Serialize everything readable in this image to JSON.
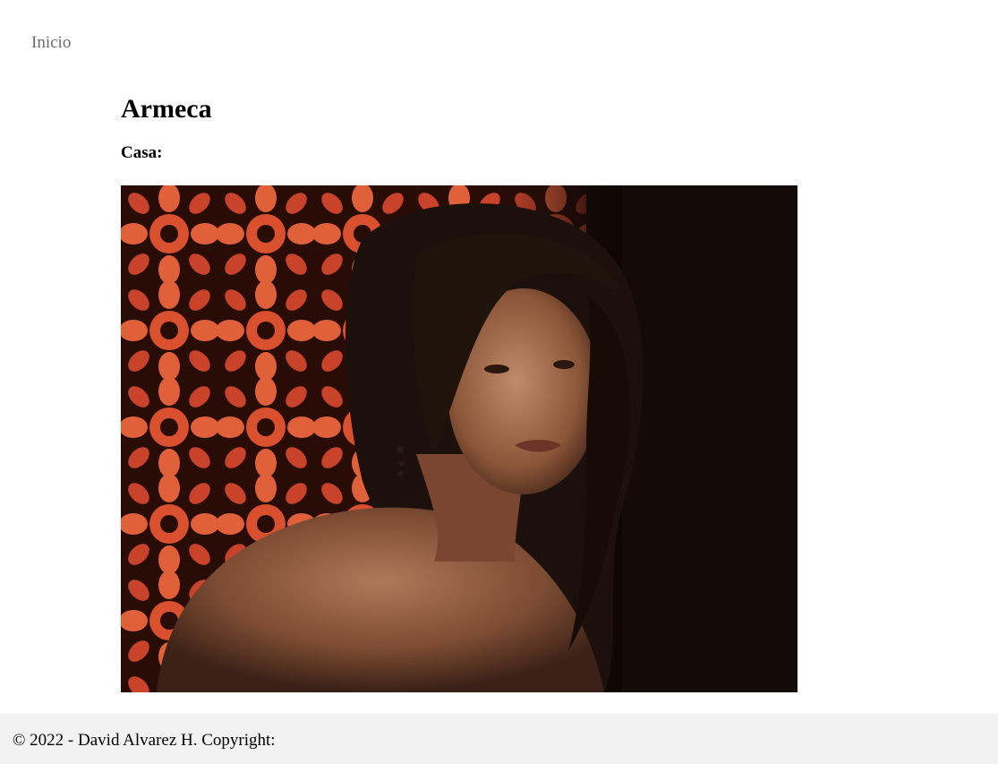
{
  "nav": {
    "home_label": "Inicio"
  },
  "character": {
    "name": "Armeca",
    "house_label": "Casa:",
    "house_value": ""
  },
  "photo": {
    "subject": "portrait",
    "background_pattern_color": "#d9502f",
    "background_dark_color": "#140a07"
  },
  "footer": {
    "copyright_text": "© 2022 - David Alvarez H. Copyright:"
  }
}
